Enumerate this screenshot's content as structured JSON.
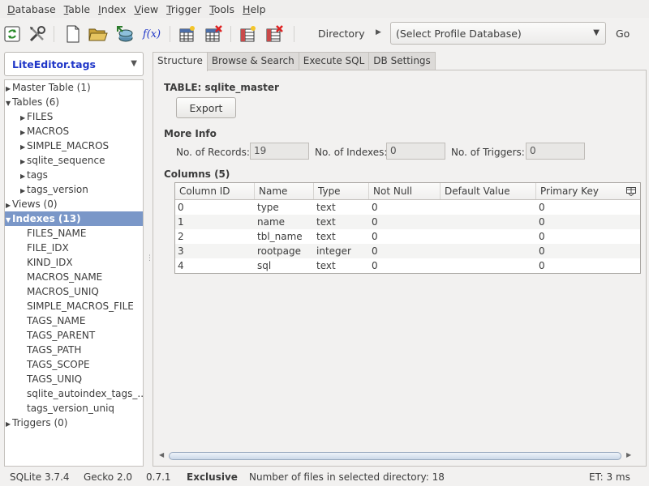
{
  "menubar": {
    "items": [
      "Database",
      "Table",
      "Index",
      "View",
      "Trigger",
      "Tools",
      "Help"
    ]
  },
  "toolbar": {
    "function_label": "f(x)",
    "directory_label": "Directory",
    "profile_select": "(Select Profile Database)",
    "go_label": "Go",
    "icons": [
      "refresh-icon",
      "tools-icon",
      "new-db-icon",
      "open-folder-icon",
      "attach-db-icon",
      "function-icon",
      "create-table-icon",
      "drop-table-icon",
      "create-index-icon",
      "drop-index-icon"
    ]
  },
  "left": {
    "db_name": "LiteEditor.tags",
    "tree": [
      {
        "label": "Master Table (1)",
        "level": 0,
        "arrow": "right"
      },
      {
        "label": "Tables (6)",
        "level": 0,
        "arrow": "down"
      },
      {
        "label": "FILES",
        "level": 1,
        "arrow": "right"
      },
      {
        "label": "MACROS",
        "level": 1,
        "arrow": "right"
      },
      {
        "label": "SIMPLE_MACROS",
        "level": 1,
        "arrow": "right"
      },
      {
        "label": "sqlite_sequence",
        "level": 1,
        "arrow": "right"
      },
      {
        "label": "tags",
        "level": 1,
        "arrow": "right"
      },
      {
        "label": "tags_version",
        "level": 1,
        "arrow": "right"
      },
      {
        "label": "Views (0)",
        "level": 0,
        "arrow": "right"
      },
      {
        "label": "Indexes (13)",
        "level": 0,
        "arrow": "down",
        "selected": true
      },
      {
        "label": "FILES_NAME",
        "level": 1,
        "arrow": ""
      },
      {
        "label": "FILE_IDX",
        "level": 1,
        "arrow": ""
      },
      {
        "label": "KIND_IDX",
        "level": 1,
        "arrow": ""
      },
      {
        "label": "MACROS_NAME",
        "level": 1,
        "arrow": ""
      },
      {
        "label": "MACROS_UNIQ",
        "level": 1,
        "arrow": ""
      },
      {
        "label": "SIMPLE_MACROS_FILE",
        "level": 1,
        "arrow": ""
      },
      {
        "label": "TAGS_NAME",
        "level": 1,
        "arrow": ""
      },
      {
        "label": "TAGS_PARENT",
        "level": 1,
        "arrow": ""
      },
      {
        "label": "TAGS_PATH",
        "level": 1,
        "arrow": ""
      },
      {
        "label": "TAGS_SCOPE",
        "level": 1,
        "arrow": ""
      },
      {
        "label": "TAGS_UNIQ",
        "level": 1,
        "arrow": ""
      },
      {
        "label": "sqlite_autoindex_tags_...",
        "level": 1,
        "arrow": ""
      },
      {
        "label": "tags_version_uniq",
        "level": 1,
        "arrow": ""
      },
      {
        "label": "Triggers (0)",
        "level": 0,
        "arrow": "right"
      }
    ]
  },
  "tabs": [
    "Structure",
    "Browse & Search",
    "Execute SQL",
    "DB Settings"
  ],
  "structure": {
    "table_title": "TABLE: sqlite_master",
    "export_label": "Export",
    "more_info_title": "More Info",
    "records_label": "No. of Records:",
    "records_value": "19",
    "indexes_label": "No. of Indexes:",
    "indexes_value": "0",
    "triggers_label": "No. of Triggers:",
    "triggers_value": "0",
    "columns_title": "Columns (5)",
    "columns_headers": [
      "Column ID",
      "Name",
      "Type",
      "Not Null",
      "Default Value",
      "Primary Key"
    ],
    "columns_rows": [
      [
        "0",
        "type",
        "text",
        "0",
        "",
        "0"
      ],
      [
        "1",
        "name",
        "text",
        "0",
        "",
        "0"
      ],
      [
        "2",
        "tbl_name",
        "text",
        "0",
        "",
        "0"
      ],
      [
        "3",
        "rootpage",
        "integer",
        "0",
        "",
        "0"
      ],
      [
        "4",
        "sql",
        "text",
        "0",
        "",
        "0"
      ]
    ]
  },
  "status": {
    "sqlite_version": "SQLite 3.7.4",
    "gecko": "Gecko 2.0",
    "app_version": "0.7.1",
    "lock_mode": "Exclusive",
    "files_info": "Number of files in selected directory: 18",
    "elapsed": "ET: 3 ms"
  }
}
